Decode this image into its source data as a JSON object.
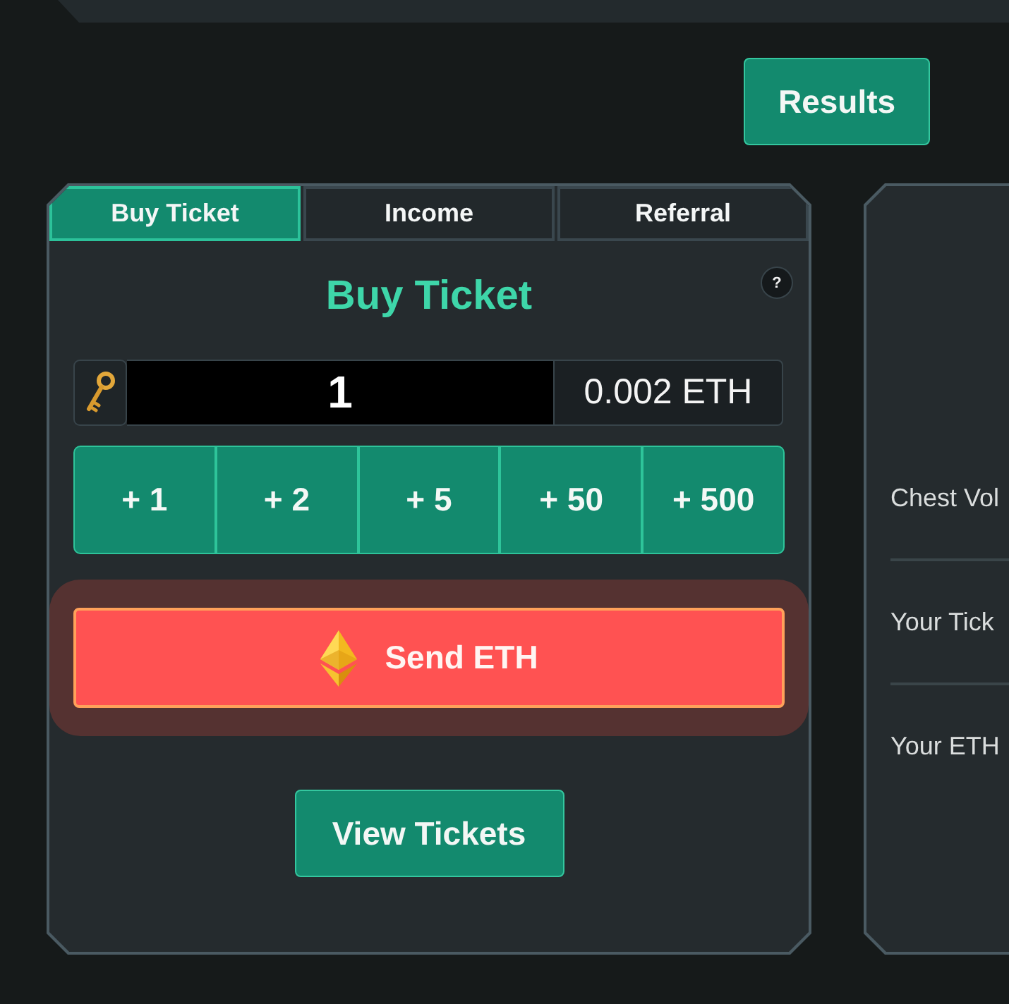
{
  "header": {
    "results_button": "Results"
  },
  "buy_panel": {
    "tabs": [
      {
        "label": "Buy Ticket",
        "selected": true
      },
      {
        "label": "Income",
        "selected": false
      },
      {
        "label": "Referral",
        "selected": false
      }
    ],
    "title": "Buy Ticket",
    "help": "?",
    "quantity": {
      "value": "1"
    },
    "price": "0.002 ETH",
    "increments": [
      "+ 1",
      "+ 2",
      "+ 5",
      "+ 50",
      "+ 500"
    ],
    "send": {
      "label": "Send ETH",
      "highlighted": true
    },
    "view_tickets_button": "View Tickets"
  },
  "stats_panel": {
    "rows": [
      "Chest Vol",
      "Your Tick",
      "Your ETH"
    ]
  }
}
